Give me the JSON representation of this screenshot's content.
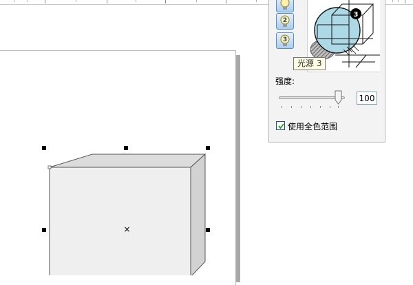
{
  "docker": {
    "light_buttons": [
      {
        "number": "1",
        "icon": "light-bulb-icon"
      },
      {
        "number": "2",
        "icon": "light-bulb-icon"
      },
      {
        "number": "3",
        "icon": "light-bulb-icon"
      }
    ],
    "preview": {
      "active_light_number": "3"
    },
    "tooltip": "光源 3",
    "intensity_label": "强度:",
    "intensity_value": "100",
    "intensity_fraction": 1.0,
    "use_full_color_label": "使用全色范围",
    "use_full_color_checked": true
  },
  "colors": {
    "accent_blue": "#add8e6",
    "button_border": "#5b8fc9",
    "cube_front": "#efefef",
    "cube_top": "#dcdcdc",
    "cube_side": "#d2d2d2"
  }
}
